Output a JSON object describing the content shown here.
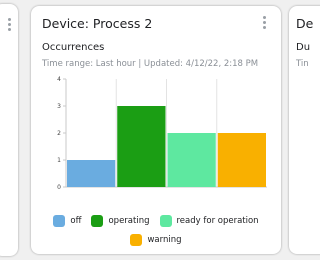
{
  "card": {
    "title": "Device: Process 2",
    "section_title": "Occurrences",
    "meta": "Time range: Last hour | Updated: 4/12/22, 2:18 PM"
  },
  "next_card": {
    "title_partial": "De",
    "section_partial": "Du",
    "meta_partial": "Tin"
  },
  "chart_data": {
    "type": "bar",
    "categories": [
      "off",
      "operating",
      "ready for operation",
      "warning"
    ],
    "values": [
      1,
      3,
      2,
      2
    ],
    "colors": [
      "#6aace0",
      "#1b9e14",
      "#5ee8a0",
      "#f9b000"
    ],
    "ylim": [
      0,
      4
    ],
    "yticks": [
      "0",
      "1",
      "2",
      "3",
      "4"
    ],
    "grid": true,
    "legend_position": "bottom"
  },
  "legend": {
    "items": [
      {
        "label": "off",
        "color": "#6aace0"
      },
      {
        "label": "operating",
        "color": "#1b9e14"
      },
      {
        "label": "ready for operation",
        "color": "#5ee8a0"
      },
      {
        "label": "warning",
        "color": "#f9b000"
      }
    ]
  },
  "icons": {
    "card_menu": "more-vert-icon",
    "left_card_menu": "more-vert-icon"
  }
}
